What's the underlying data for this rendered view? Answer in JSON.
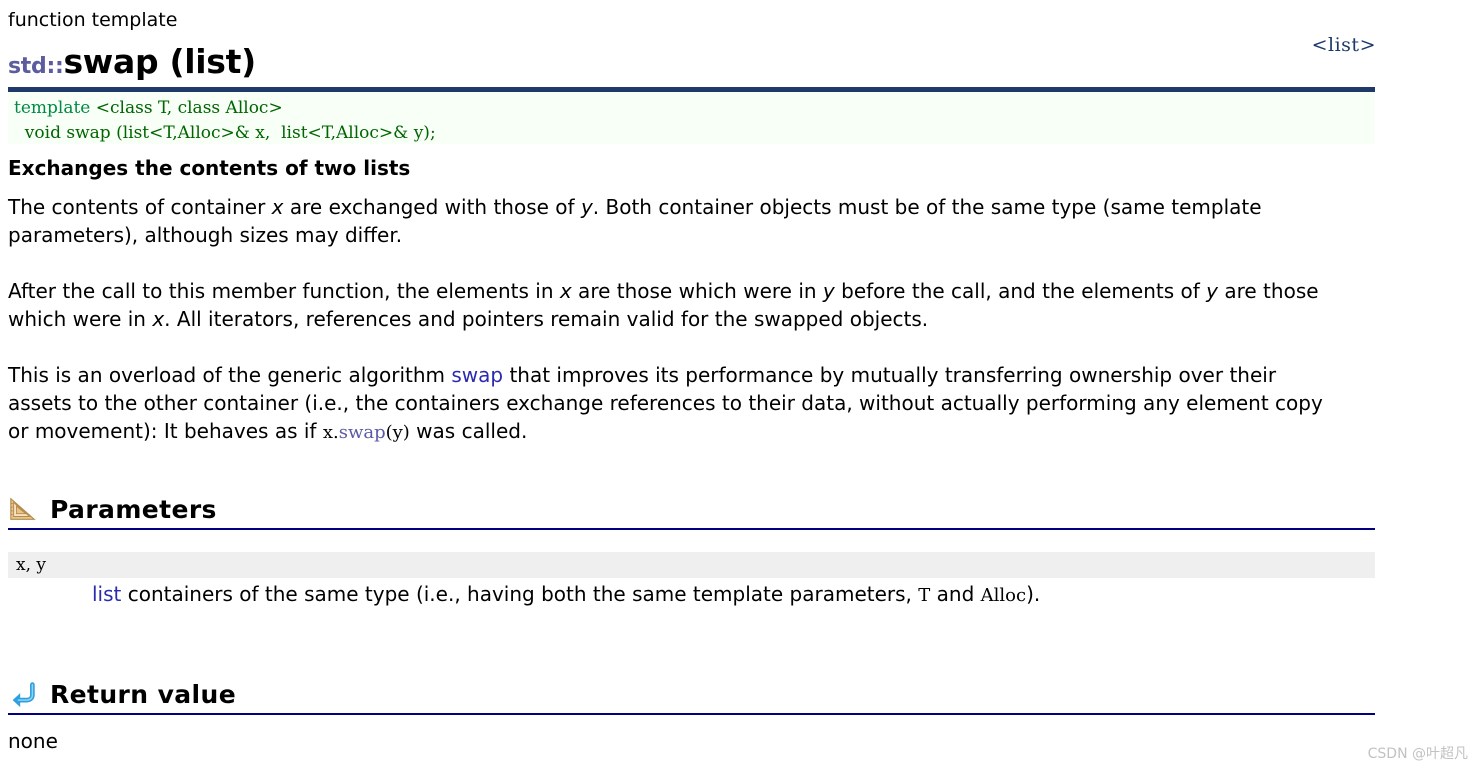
{
  "header": {
    "kicker": "function template",
    "namespace": "std::",
    "name": "swap (list)",
    "include": "<list>"
  },
  "prototype": {
    "line1_kw": "template",
    "line1_rest": " <class T, class Alloc>",
    "line2": "  void swap (list<T,Alloc>& x,  list<T,Alloc>& y);"
  },
  "lead": "Exchanges the contents of two lists",
  "paragraphs": {
    "p1_a": "The contents of container ",
    "p1_x": "x",
    "p1_b": " are exchanged with those of ",
    "p1_y": "y",
    "p1_c": ". Both container objects must be of the same type (same template parameters), although sizes may differ.",
    "p2_a": "After the call to this member function, the elements in ",
    "p2_x1": "x",
    "p2_b": " are those which were in ",
    "p2_y1": "y",
    "p2_c": " before the call, and the elements of ",
    "p2_y2": "y",
    "p2_d": " are those which were in ",
    "p2_x2": "x",
    "p2_e": ". All iterators, references and pointers remain valid for the swapped objects.",
    "p3_a": "This is an overload of the generic algorithm ",
    "p3_link": "swap",
    "p3_b": " that improves its performance by mutually transferring ownership over their assets to the other container (i.e., the containers exchange references to their data, without actually performing any element copy or movement): It behaves as if ",
    "p3_code_x": "x.",
    "p3_code_swap": "swap",
    "p3_code_y": "(y)",
    "p3_c": " was called."
  },
  "sections": {
    "parameters": {
      "title": "Parameters",
      "icon": "ruler-triangle-icon",
      "param_name": "x, y",
      "desc_link": "list",
      "desc_a": " containers of the same type (i.e., having both the same template parameters, ",
      "desc_code_t": "T",
      "desc_b": " and ",
      "desc_code_alloc": "Alloc",
      "desc_c": ")."
    },
    "return_value": {
      "title": "Return value",
      "icon": "return-arrow-icon",
      "value": "none"
    }
  },
  "watermark": "CSDN @叶超凡",
  "colors": {
    "namespace": "#5c5c9e",
    "rule": "#000080",
    "proto_bar": "#1f3a68",
    "proto_bg": "#f7fff7",
    "code_keyword": "#008b45",
    "code_text": "#006400",
    "link": "#2b2bb0",
    "param_band": "#efefef",
    "watermark": "#c2c2c2"
  }
}
